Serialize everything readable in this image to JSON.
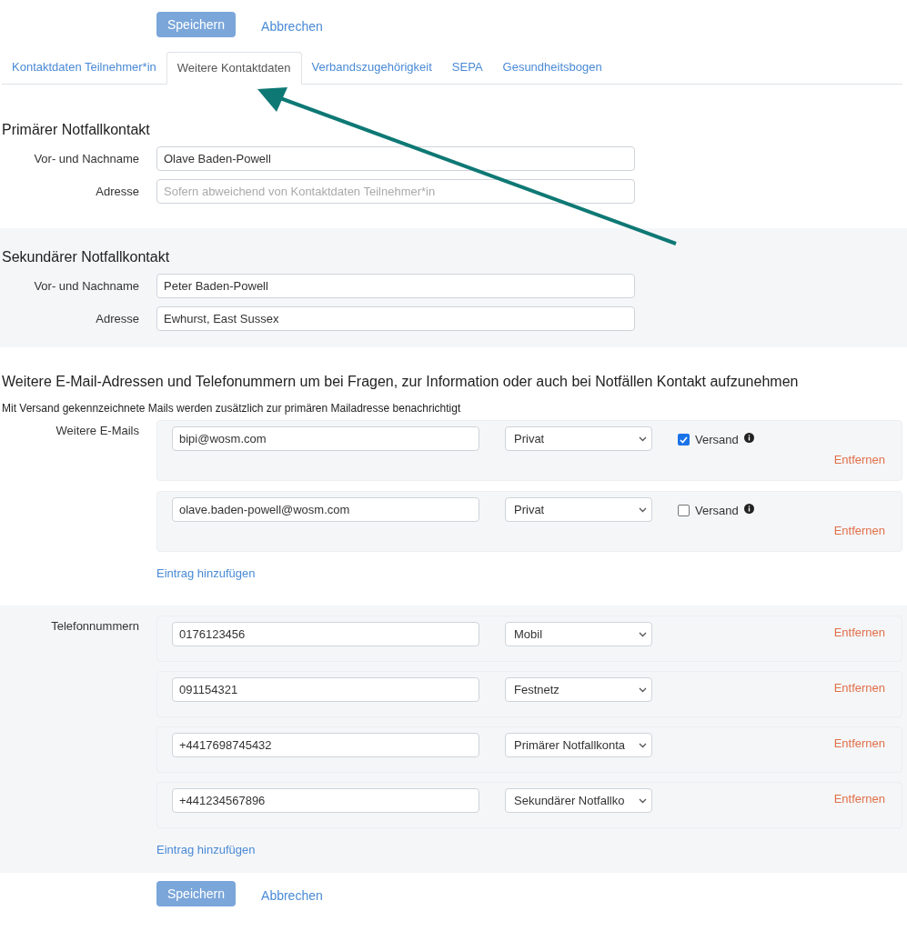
{
  "top_actions": {
    "save": "Speichern",
    "cancel": "Abbrechen"
  },
  "tabs": [
    {
      "label": "Kontaktdaten Teilnehmer*in",
      "selected": false
    },
    {
      "label": "Weitere Kontaktdaten",
      "selected": true
    },
    {
      "label": "Verbandszugehörigkeit",
      "selected": false
    },
    {
      "label": "SEPA",
      "selected": false
    },
    {
      "label": "Gesundheitsbogen",
      "selected": false
    }
  ],
  "primary_contact": {
    "title": "Primärer Notfallkontakt",
    "fields": [
      {
        "label": "Vor- und Nachname",
        "value": "Olave Baden-Powell"
      },
      {
        "label": "Adresse",
        "placeholder": "Sofern abweichend von Kontaktdaten Teilnehmer*in"
      }
    ]
  },
  "secondary_contact": {
    "title": "Sekundärer Notfallkontakt",
    "fields": [
      {
        "label": "Vor- und Nachname",
        "value": "Peter Baden-Powell"
      },
      {
        "label": "Adresse",
        "value": "Ewhurst, East Sussex"
      }
    ]
  },
  "additional": {
    "title": "Weitere E-Mail-Adressen und Telefonummern um bei Fragen, zur Information oder auch bei Notfällen Kontakt aufzunehmen",
    "note": "Mit Versand gekennzeichnete Mails werden zusätzlich zur primären Mailadresse benachrichtigt"
  },
  "emails": {
    "label": "Weitere E-Mails",
    "entries": [
      {
        "value": "bipi@wosm.com",
        "type": "Privat",
        "versand": {
          "label": "Versand",
          "checked": true
        },
        "remove": "Entfernen"
      },
      {
        "value": "olave.baden-powell@wosm.com",
        "type": "Privat",
        "versand": {
          "label": "Versand",
          "checked": false
        },
        "remove": "Entfernen"
      }
    ],
    "add": "Eintrag hinzufügen"
  },
  "phones": {
    "label": "Telefonnummern",
    "entries": [
      {
        "value": "0176123456",
        "type": "Mobil",
        "remove": "Entfernen"
      },
      {
        "value": "091154321",
        "type": "Festnetz",
        "remove": "Entfernen"
      },
      {
        "value": "+4417698745432",
        "type": "Primärer Notfallkonta",
        "remove": "Entfernen"
      },
      {
        "value": "+441234567896",
        "type": "Sekundärer Notfallko",
        "remove": "Entfernen"
      }
    ],
    "add": "Eintrag hinzufügen"
  },
  "bottom_actions": {
    "save": "Speichern",
    "cancel": "Abbrechen"
  }
}
